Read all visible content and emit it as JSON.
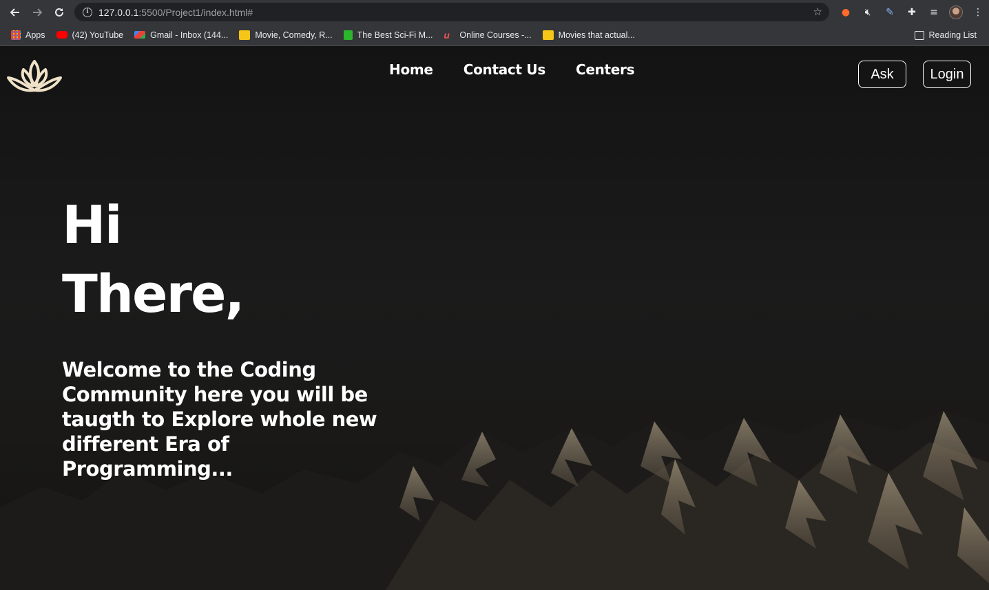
{
  "browser": {
    "url_host": "127.0.0.1",
    "url_rest": ":5500/Project1/index.html#",
    "bookmarks": [
      {
        "label": "Apps",
        "color": "#4285f4"
      },
      {
        "label": "(42) YouTube",
        "color": "#ff0000"
      },
      {
        "label": "Gmail - Inbox (144...",
        "color": "#ea4335"
      },
      {
        "label": "Movie, Comedy, R...",
        "color": "#f5c518"
      },
      {
        "label": "The Best Sci-Fi M...",
        "color": "#3ec63e"
      },
      {
        "label": "Online Courses -...",
        "color": "#ec5252"
      },
      {
        "label": "Movies that actual...",
        "color": "#f5c518"
      }
    ],
    "reading_list": "Reading List"
  },
  "nav": {
    "links": [
      "Home",
      "Contact Us",
      "Centers"
    ],
    "ask_label": "Ask",
    "login_label": "Login"
  },
  "hero": {
    "line1": "Hi",
    "line2": "There,",
    "tagline": "Welcome to the Coding Community here you will be taugth to Explore whole new different Era of Programming..."
  },
  "colors": {
    "text": "#ffffff",
    "background": "#1a1a1a",
    "chrome": "#35363a"
  }
}
